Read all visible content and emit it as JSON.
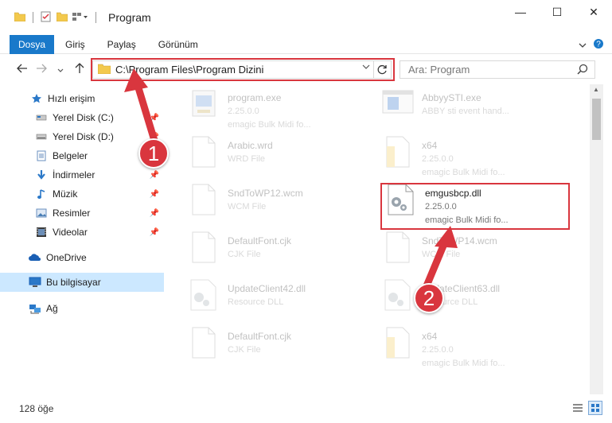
{
  "window": {
    "title": "Program",
    "minimize_glyph": "—",
    "maximize_glyph": "☐",
    "close_glyph": "✕"
  },
  "ribbon": {
    "file_tab": "Dosya",
    "tabs": [
      "Giriş",
      "Paylaş",
      "Görünüm"
    ]
  },
  "navigation": {
    "address_path": "C:\\Program Files\\Program Dizini",
    "search_placeholder": "Ara: Program"
  },
  "sidebar": {
    "items": [
      {
        "label": "Hızlı erişim",
        "icon": "star-icon",
        "pinned": false
      },
      {
        "label": "Yerel Disk (C:)",
        "icon": "drive-icon",
        "pinned": true
      },
      {
        "label": "Yerel Disk (D:)",
        "icon": "drive-icon",
        "pinned": true
      },
      {
        "label": "Belgeler",
        "icon": "documents-icon",
        "pinned": true
      },
      {
        "label": "İndirmeler",
        "icon": "download-icon",
        "pinned": true
      },
      {
        "label": "Müzik",
        "icon": "music-icon",
        "pinned": true
      },
      {
        "label": "Resimler",
        "icon": "pictures-icon",
        "pinned": true
      },
      {
        "label": "Videolar",
        "icon": "video-icon",
        "pinned": true
      },
      {
        "label": "OneDrive",
        "icon": "cloud-icon",
        "pinned": false
      },
      {
        "label": "Bu bilgisayar",
        "icon": "computer-icon",
        "pinned": false
      },
      {
        "label": "Ağ",
        "icon": "network-icon",
        "pinned": false
      }
    ]
  },
  "files": [
    {
      "name": "program.exe",
      "line2": "2.25.0.0",
      "line3": "emagic Bulk Midi fo...",
      "icon": "exe-icon"
    },
    {
      "name": "AbbyySTI.exe",
      "line2": "ABBY sti event hand...",
      "line3": "",
      "icon": "exe-window-icon"
    },
    {
      "name": "Arabic.wrd",
      "line2": "WRD File",
      "line3": "",
      "icon": "blank-file-icon"
    },
    {
      "name": "x64",
      "line2": "2.25.0.0",
      "line3": "emagic Bulk Midi fo...",
      "icon": "folder-file-icon"
    },
    {
      "name": "SndToWP12.wcm",
      "line2": "WCM File",
      "line3": "",
      "icon": "blank-file-icon"
    },
    {
      "name": "emgusbcp.dll",
      "line2": "2.25.0.0",
      "line3": "emagic Bulk Midi fo...",
      "icon": "dll-gear-icon"
    },
    {
      "name": "DefaultFont.cjk",
      "line2": "CJK File",
      "line3": "",
      "icon": "blank-file-icon"
    },
    {
      "name": "SndToWP14.wcm",
      "line2": "WCM File",
      "line3": "",
      "icon": "blank-file-icon"
    },
    {
      "name": "UpdateClient42.dll",
      "line2": "Resource DLL",
      "line3": "",
      "icon": "dll-gear-icon"
    },
    {
      "name": "UpdateClient63.dll",
      "line2": "Resource DLL",
      "line3": "",
      "icon": "dll-gear-icon"
    },
    {
      "name": "DefaultFont.cjk",
      "line2": "CJK File",
      "line3": "",
      "icon": "blank-file-icon"
    },
    {
      "name": "x64",
      "line2": "2.25.0.0",
      "line3": "emagic Bulk Midi fo...",
      "icon": "folder-file-icon"
    }
  ],
  "status": {
    "item_count": "128 öğe"
  },
  "annotations": {
    "marker_1": "1",
    "marker_2": "2",
    "highlight_color": "#d9363e"
  },
  "colors": {
    "accent": "#1979ca",
    "selected_bg": "#cce8ff"
  }
}
